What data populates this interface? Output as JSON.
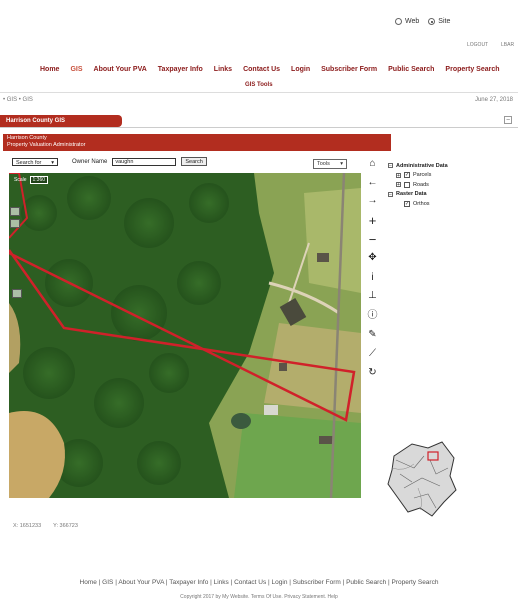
{
  "view_toggle": {
    "web_label": "Web",
    "site_label": "Site",
    "selected": "Site"
  },
  "top_links": {
    "logout": "LOGOUT",
    "lbar": "LBAR"
  },
  "nav": [
    "Home",
    "GIS",
    "About Your PVA",
    "Taxpayer Info",
    "Links",
    "Contact Us",
    "Login",
    "Subscriber Form",
    "Public Search",
    "Property Search"
  ],
  "subnav": "GIS Tools",
  "breadcrumb": "• GIS • GIS",
  "date": "June 27, 2018",
  "panel_title": "Harrison County GIS",
  "banner": {
    "line1": "Harrison County",
    "line2": "Property Valuation Administrator"
  },
  "search": {
    "select_value": "Search for",
    "owner_label": "Owner Name",
    "owner_value": "vaughn",
    "button": "Search"
  },
  "tools_label": "Tools",
  "scale": {
    "label": "Scale",
    "value": "1:360"
  },
  "legend": {
    "groups": [
      {
        "title": "Administrative Data",
        "layers": [
          {
            "name": "Parcels",
            "checked": true
          },
          {
            "name": "Roads",
            "checked": false
          }
        ]
      },
      {
        "title": "Raster Data",
        "layers": [
          {
            "name": "Orthos",
            "checked": true
          }
        ]
      }
    ]
  },
  "map_icons": [
    "home-icon",
    "back-arrow-icon",
    "forward-arrow-icon",
    "zoom-in-icon",
    "zoom-out-icon",
    "pan-icon",
    "identify-icon",
    "select-icon",
    "info-icon",
    "measure-icon",
    "draw-icon",
    "refresh-icon"
  ],
  "coords": {
    "x": "X: 1651233",
    "y": "Y: 366723"
  },
  "footer": "Home | GIS | About Your PVA | Taxpayer Info | Links | Contact Us | Login | Subscriber Form | Public Search | Property Search",
  "copyright": "Copyright 2017 by My Website. Terms Of Use. Privacy Statement. Help"
}
